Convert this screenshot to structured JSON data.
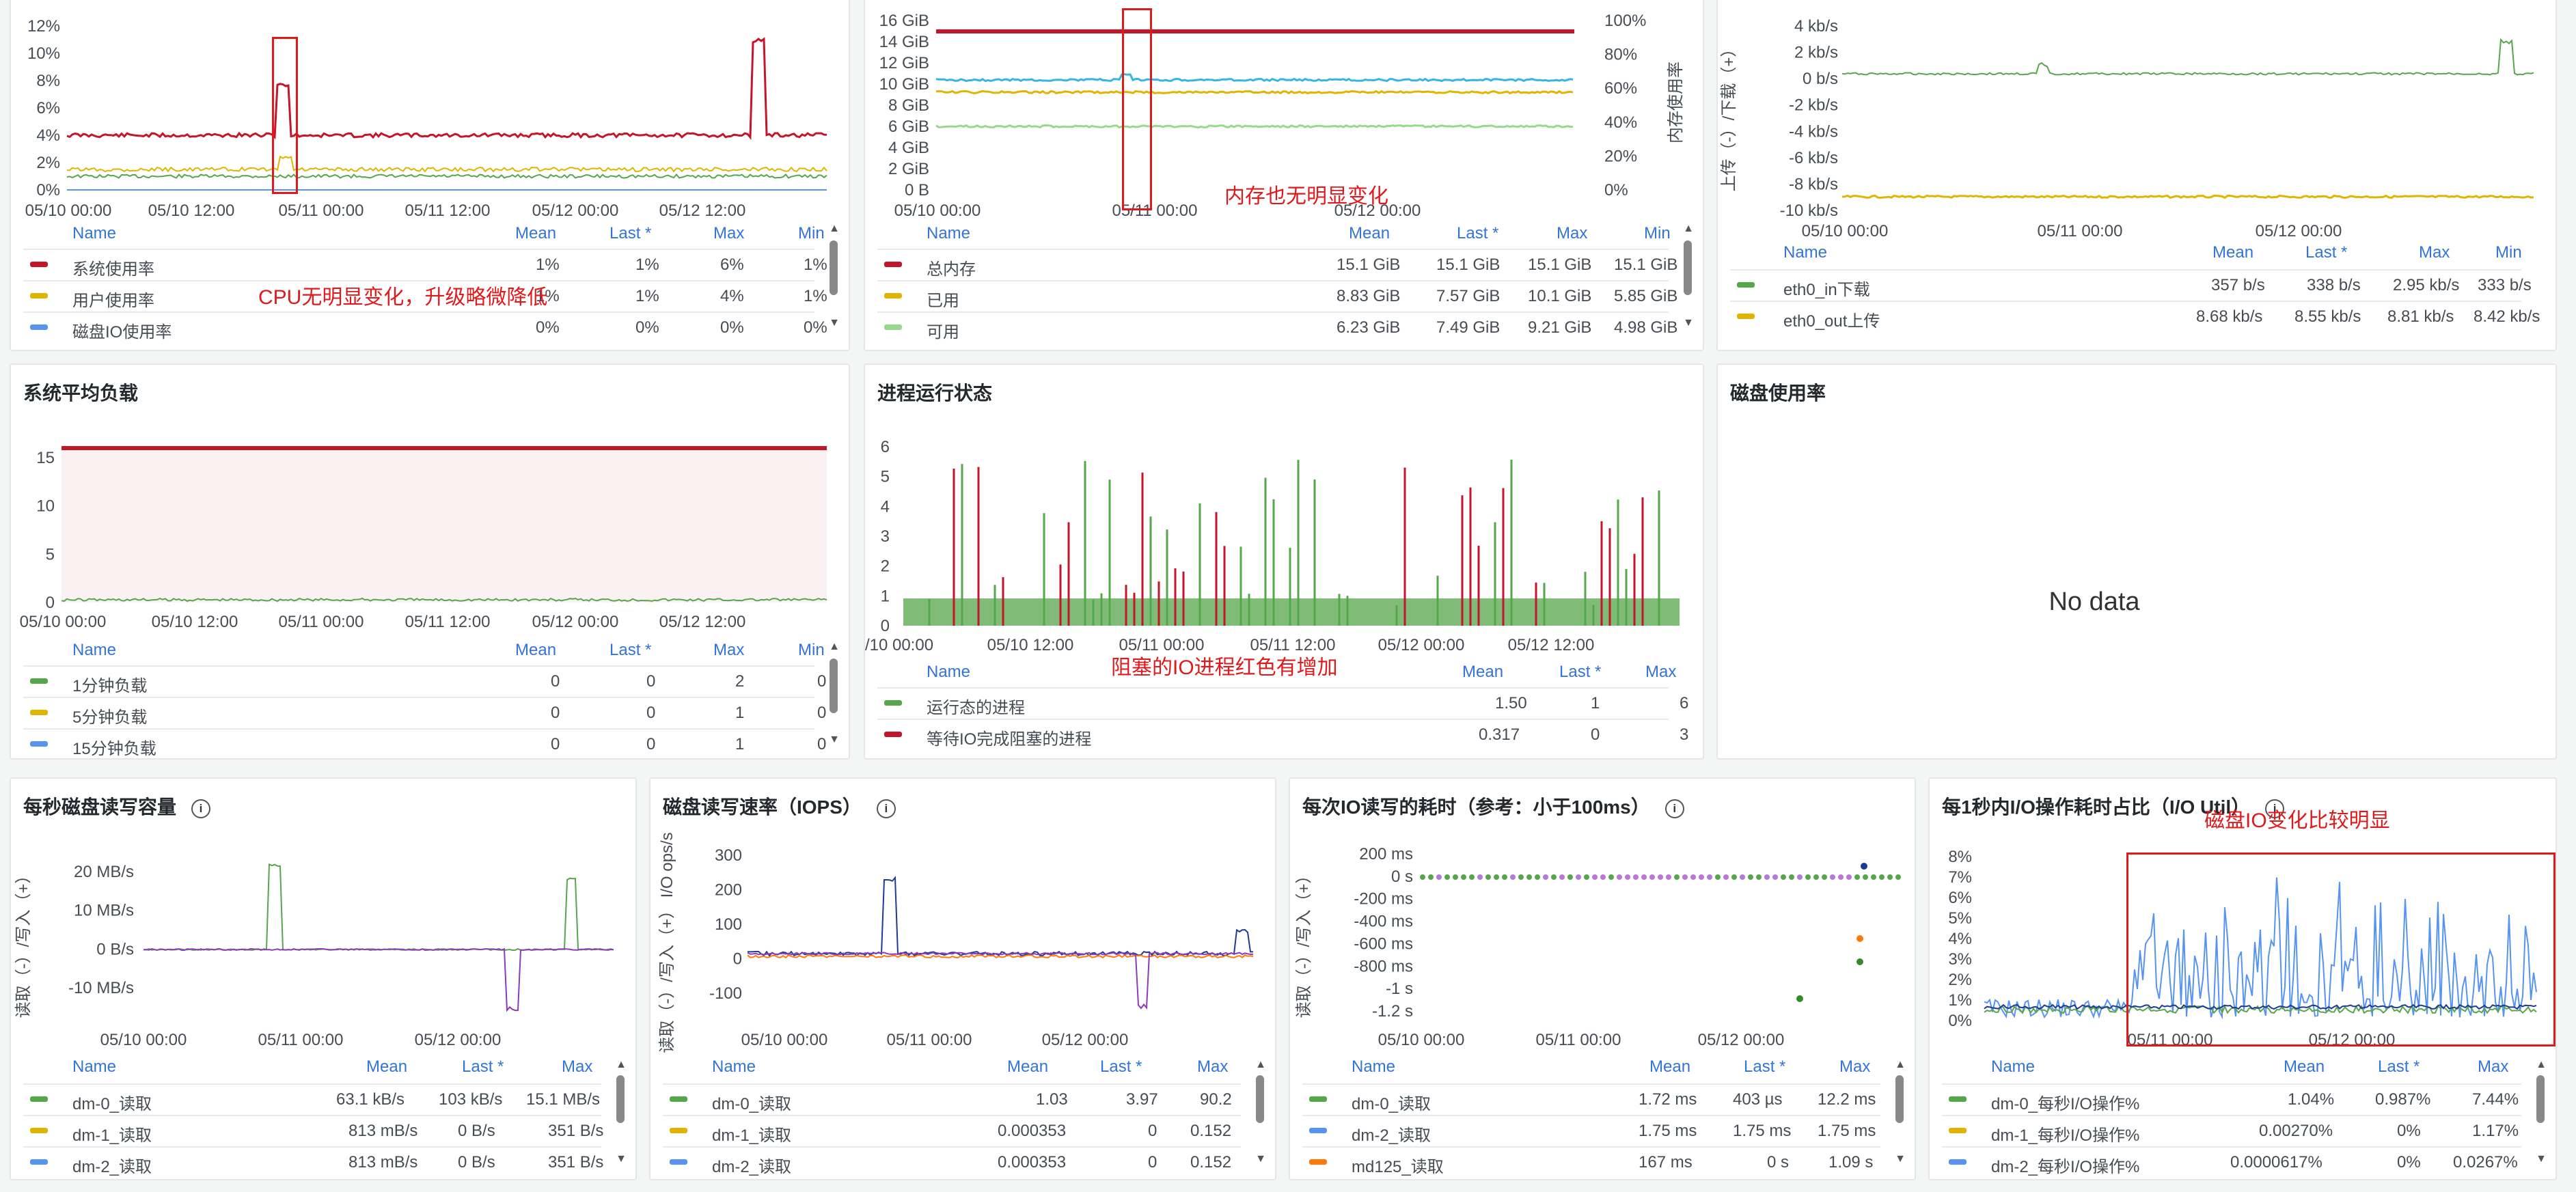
{
  "colors": {
    "red": "#c4162a",
    "yellow": "#e0b400",
    "green": "#56a64b",
    "blue": "#5794f2",
    "lightgreen": "#96d98d",
    "cyan": "#33b5e5",
    "orange": "#ff780a",
    "purple": "#8f3bb8",
    "navy": "#1f3a93",
    "darkgreen": "#37872d",
    "header": "#3274d9"
  },
  "legend_header": {
    "name": "Name",
    "mean": "Mean",
    "last": "Last *",
    "max": "Max",
    "min": "Min"
  },
  "no_data": "No data",
  "annotations": {
    "cpu": "CPU无明显变化，升级略微降低",
    "mem": "内存也无明显变化",
    "proc": "阻塞的IO进程红色有增加",
    "util": "磁盘IO变化比较明显"
  },
  "panels": {
    "cpu": {
      "y_ticks": [
        "12%",
        "10%",
        "8%",
        "6%",
        "4%",
        "2%",
        "0%"
      ],
      "x_ticks": [
        "05/10 00:00",
        "05/10 12:00",
        "05/11 00:00",
        "05/11 12:00",
        "05/12 00:00",
        "05/12 12:00"
      ],
      "legend": [
        {
          "name": "系统使用率",
          "mean": "1%",
          "last": "1%",
          "max": "6%",
          "min": "1%",
          "color": "#c4162a"
        },
        {
          "name": "用户使用率",
          "mean": "1%",
          "last": "1%",
          "max": "4%",
          "min": "1%",
          "color": "#e0b400"
        },
        {
          "name": "磁盘IO使用率",
          "mean": "0%",
          "last": "0%",
          "max": "0%",
          "min": "0%",
          "color": "#5794f2"
        }
      ]
    },
    "mem": {
      "y_ticks": [
        "16 GiB",
        "14 GiB",
        "12 GiB",
        "10 GiB",
        "8 GiB",
        "6 GiB",
        "4 GiB",
        "2 GiB",
        "0 B"
      ],
      "y2_ticks": [
        "100%",
        "80%",
        "60%",
        "40%",
        "20%",
        "0%"
      ],
      "y2_label": "内存使用率",
      "x_ticks": [
        "05/10 00:00",
        "05/11 00:00",
        "05/12 00:00"
      ],
      "legend": [
        {
          "name": "总内存",
          "mean": "15.1 GiB",
          "last": "15.1 GiB",
          "max": "15.1 GiB",
          "min": "15.1 GiB",
          "color": "#c4162a"
        },
        {
          "name": "已用",
          "mean": "8.83 GiB",
          "last": "7.57 GiB",
          "max": "10.1 GiB",
          "min": "5.85 GiB",
          "color": "#e0b400"
        },
        {
          "name": "可用",
          "mean": "6.23 GiB",
          "last": "7.49 GiB",
          "max": "9.21 GiB",
          "min": "4.98 GiB",
          "color": "#96d98d"
        }
      ]
    },
    "net": {
      "y_ticks": [
        "4 kb/s",
        "2 kb/s",
        "0 b/s",
        "-2 kb/s",
        "-4 kb/s",
        "-6 kb/s",
        "-8 kb/s",
        "-10 kb/s"
      ],
      "y_label": "上传（-）/下载（+）",
      "x_ticks": [
        "05/10 00:00",
        "05/11 00:00",
        "05/12 00:00"
      ],
      "legend": [
        {
          "name": "eth0_in下载",
          "mean": "357 b/s",
          "last": "338 b/s",
          "max": "2.95 kb/s",
          "min": "333 b/s",
          "color": "#56a64b"
        },
        {
          "name": "eth0_out上传",
          "mean": "8.68 kb/s",
          "last": "8.55 kb/s",
          "max": "8.81 kb/s",
          "min": "8.42 kb/s",
          "color": "#e0b400"
        }
      ]
    },
    "load": {
      "title": "系统平均负载",
      "y_ticks": [
        "15",
        "10",
        "5",
        "0"
      ],
      "x_ticks": [
        "05/10 00:00",
        "05/10 12:00",
        "05/11 00:00",
        "05/11 12:00",
        "05/12 00:00",
        "05/12 12:00"
      ],
      "legend": [
        {
          "name": "1分钟负载",
          "mean": "0",
          "last": "0",
          "max": "2",
          "min": "0",
          "color": "#56a64b"
        },
        {
          "name": "5分钟负载",
          "mean": "0",
          "last": "0",
          "max": "1",
          "min": "0",
          "color": "#e0b400"
        },
        {
          "name": "15分钟负载",
          "mean": "0",
          "last": "0",
          "max": "1",
          "min": "0",
          "color": "#5794f2"
        }
      ]
    },
    "proc": {
      "title": "进程运行状态",
      "y_ticks": [
        "6",
        "5",
        "4",
        "3",
        "2",
        "1",
        "0"
      ],
      "x_ticks": [
        "/10 00:00",
        "05/10 12:00",
        "05/11 00:00",
        "05/11 12:00",
        "05/12 00:00",
        "05/12 12:00"
      ],
      "legend": [
        {
          "name": "运行态的进程",
          "mean": "1.50",
          "last": "1",
          "max": "6",
          "color": "#56a64b"
        },
        {
          "name": "等待IO完成阻塞的进程",
          "mean": "0.317",
          "last": "0",
          "max": "3",
          "color": "#c4162a"
        }
      ]
    },
    "diskuse": {
      "title": "磁盘使用率"
    },
    "rw": {
      "title": "每秒磁盘读写容量",
      "y_ticks": [
        "20 MB/s",
        "10 MB/s",
        "0 B/s",
        "-10 MB/s"
      ],
      "y_label": "读取（-）/写入（+）",
      "x_ticks": [
        "05/10 00:00",
        "05/11 00:00",
        "05/12 00:00"
      ],
      "legend": [
        {
          "name": "dm-0_读取",
          "mean": "63.1 kB/s",
          "last": "103 kB/s",
          "max": "15.1 MB/s",
          "color": "#56a64b"
        },
        {
          "name": "dm-1_读取",
          "mean": "813 mB/s",
          "last": "0 B/s",
          "max": "351 B/s",
          "color": "#e0b400"
        },
        {
          "name": "dm-2_读取",
          "mean": "813 mB/s",
          "last": "0 B/s",
          "max": "351 B/s",
          "color": "#5794f2"
        }
      ]
    },
    "iops": {
      "title": "磁盘读写速率（IOPS）",
      "y_ticks": [
        "300",
        "200",
        "100",
        "0",
        "-100"
      ],
      "y_label": "读取（-）/写入（+） I/O ops/s",
      "x_ticks": [
        "05/10 00:00",
        "05/11 00:00",
        "05/12 00:00"
      ],
      "legend": [
        {
          "name": "dm-0_读取",
          "mean": "1.03",
          "last": "3.97",
          "max": "90.2",
          "color": "#56a64b"
        },
        {
          "name": "dm-1_读取",
          "mean": "0.000353",
          "last": "0",
          "max": "0.152",
          "color": "#e0b400"
        },
        {
          "name": "dm-2_读取",
          "mean": "0.000353",
          "last": "0",
          "max": "0.152",
          "color": "#5794f2"
        }
      ]
    },
    "lat": {
      "title": "每次IO读写的耗时（参考：小于100ms）",
      "y_ticks": [
        "200 ms",
        "0 s",
        "-200 ms",
        "-400 ms",
        "-600 ms",
        "-800 ms",
        "-1 s",
        "-1.2 s"
      ],
      "y_label": "读取（-）/写入（+）",
      "x_ticks": [
        "05/10 00:00",
        "05/11 00:00",
        "05/12 00:00"
      ],
      "legend": [
        {
          "name": "dm-0_读取",
          "mean": "1.72 ms",
          "last": "403 µs",
          "max": "12.2 ms",
          "color": "#56a64b"
        },
        {
          "name": "dm-2_读取",
          "mean": "1.75 ms",
          "last": "1.75 ms",
          "max": "1.75 ms",
          "color": "#5794f2"
        },
        {
          "name": "md125_读取",
          "mean": "167 ms",
          "last": "0 s",
          "max": "1.09 s",
          "color": "#ff780a"
        }
      ]
    },
    "util": {
      "title": "每1秒内I/O操作耗时占比（I/O Util）",
      "y_ticks": [
        "8%",
        "7%",
        "6%",
        "5%",
        "4%",
        "3%",
        "2%",
        "1%",
        "0%"
      ],
      "x_ticks": [
        "05/11 00:00",
        "05/12 00:00"
      ],
      "legend": [
        {
          "name": "dm-0_每秒I/O操作%",
          "mean": "1.04%",
          "last": "0.987%",
          "max": "7.44%",
          "color": "#56a64b"
        },
        {
          "name": "dm-1_每秒I/O操作%",
          "mean": "0.00270%",
          "last": "0%",
          "max": "1.17%",
          "color": "#e0b400"
        },
        {
          "name": "dm-2_每秒I/O操作%",
          "mean": "0.0000617%",
          "last": "0%",
          "max": "0.0267%",
          "color": "#5794f2"
        }
      ]
    }
  }
}
